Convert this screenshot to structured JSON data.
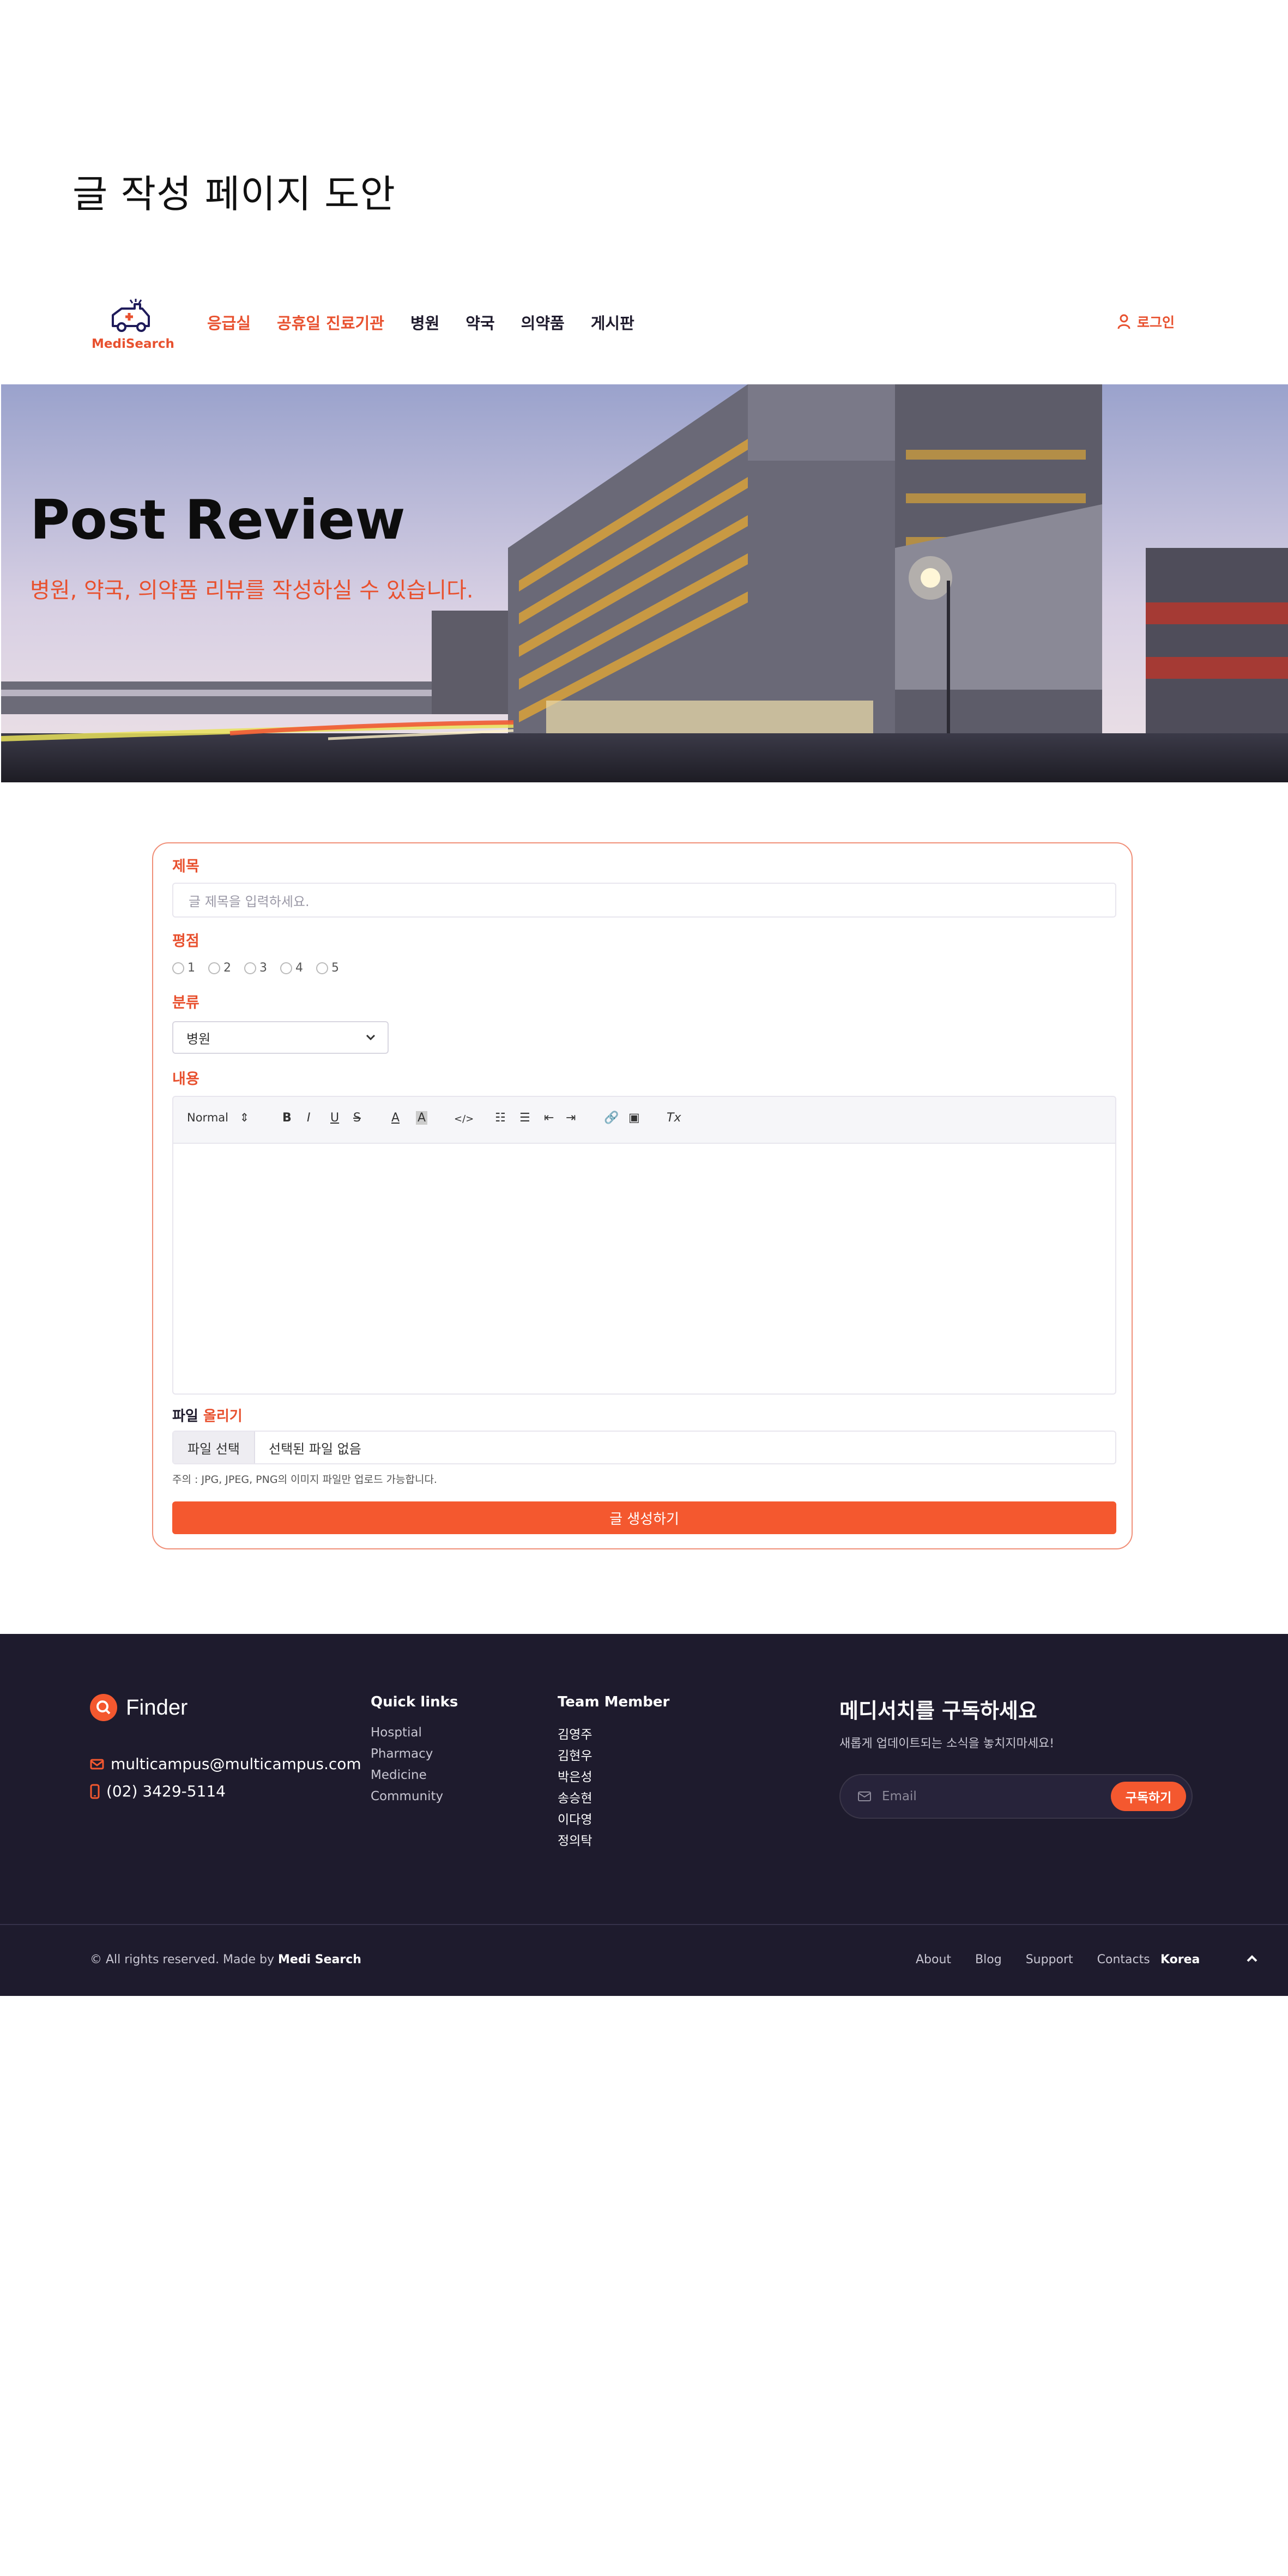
{
  "doc_title": "글 작성 페이지 도안",
  "colors": {
    "accent": "#e8512f",
    "button": "#f4582f",
    "footer_bg": "#1e1b2d"
  },
  "nav": {
    "logo_text": "MediSearch",
    "links": [
      "응급실",
      "공휴일 진료기관",
      "병원",
      "약국",
      "의약품",
      "게시판"
    ],
    "login": "로그인"
  },
  "hero": {
    "title": "Post Review",
    "subtitle": "병원, 약국, 의약품 리뷰를 작성하실 수 있습니다."
  },
  "form": {
    "title_label": "제목",
    "title_placeholder": "글 제목을 입력하세요.",
    "rating_label": "평점",
    "ratings": [
      "1",
      "2",
      "3",
      "4",
      "5"
    ],
    "category_label": "분류",
    "category_value": "병원",
    "content_label": "내용",
    "toolbar": {
      "format": "Normal",
      "bold": "B",
      "italic": "I",
      "underline": "U",
      "strike": "S",
      "color": "A",
      "background": "A",
      "code": "</>",
      "clean": "Tx"
    },
    "file_label_a": "파일",
    "file_label_b": "올리기",
    "file_button": "파일 선택",
    "file_status": "선택된 파일 없음",
    "file_note": "주의 : JPG, JPEG, PNG의 이미지 파일만 업로드 가능합니다.",
    "submit": "글 생성하기"
  },
  "footer": {
    "brand": "Finder",
    "email": "multicampus@multicampus.com",
    "phone": "(02) 3429-5114",
    "quick_links_title": "Quick links",
    "quick_links": [
      "Hosptial",
      "Pharmacy",
      "Medicine",
      "Community"
    ],
    "team_title": "Team Member",
    "team": [
      "김영주",
      "김현우",
      "박은성",
      "송승현",
      "이다영",
      "정의탁"
    ],
    "subscribe_title": "메디서치를 구독하세요",
    "subscribe_desc": "새롭게 업데이트되는 소식을 놓치지마세요!",
    "email_placeholder": "Email",
    "subscribe_button": "구독하기",
    "copyright_prefix": "© All rights reserved. Made by",
    "copyright_brand": "Medi Search",
    "bottom_links": [
      "About",
      "Blog",
      "Support",
      "Contacts"
    ],
    "region": "Korea"
  }
}
